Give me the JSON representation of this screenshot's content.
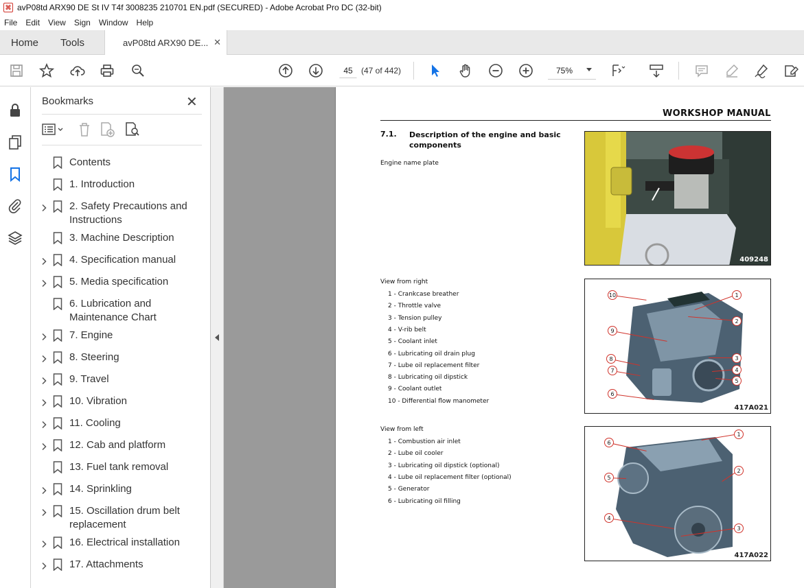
{
  "window": {
    "title": "avP08td ARX90 DE St IV T4f 3008235 210701 EN.pdf (SECURED) - Adobe Acrobat Pro DC (32-bit)"
  },
  "menu": [
    "File",
    "Edit",
    "View",
    "Sign",
    "Window",
    "Help"
  ],
  "tabs": {
    "home": "Home",
    "tools": "Tools",
    "document": "avP08td ARX90 DE..."
  },
  "toolbar": {
    "page_number": "45",
    "page_count": "(47 of 442)",
    "zoom": "75%"
  },
  "bookmarks": {
    "title": "Bookmarks",
    "items": [
      {
        "label": "Contents",
        "expandable": false
      },
      {
        "label": "1. Introduction",
        "expandable": false
      },
      {
        "label": "2. Safety Precautions and Instructions",
        "expandable": true
      },
      {
        "label": "3. Machine Description",
        "expandable": false
      },
      {
        "label": "4. Specification manual",
        "expandable": true
      },
      {
        "label": "5. Media specification",
        "expandable": true
      },
      {
        "label": "6. Lubrication and Maintenance Chart",
        "expandable": false
      },
      {
        "label": "7. Engine",
        "expandable": true
      },
      {
        "label": "8. Steering",
        "expandable": true
      },
      {
        "label": "9. Travel",
        "expandable": true
      },
      {
        "label": "10. Vibration",
        "expandable": true
      },
      {
        "label": "11. Cooling",
        "expandable": true
      },
      {
        "label": "12. Cab and platform",
        "expandable": true
      },
      {
        "label": "13. Fuel tank removal",
        "expandable": false
      },
      {
        "label": "14. Sprinkling",
        "expandable": true
      },
      {
        "label": "15. Oscillation drum belt replacement",
        "expandable": true
      },
      {
        "label": "16. Electrical installation",
        "expandable": true
      },
      {
        "label": "17. Attachments",
        "expandable": true
      }
    ]
  },
  "document": {
    "header": "WORKSHOP MANUAL",
    "section_number": "7.1.",
    "section_title": "Description of the engine and basic components",
    "nameplate_caption": "Engine name plate",
    "photo_code": "409248",
    "view_right": {
      "heading": "View from right",
      "items": [
        "1 - Crankcase breather",
        "2 - Throttle valve",
        "3 - Tension pulley",
        "4 - V-rib belt",
        "5 - Coolant inlet",
        "6 - Lubricating oil drain plug",
        "7 - Lube oil replacement filter",
        "8 - Lubricating oil dipstick",
        "9 - Coolant outlet",
        "10 - Differential flow manometer"
      ],
      "figure_code": "417A021",
      "callouts": [
        "10",
        "1",
        "2",
        "9",
        "3",
        "4",
        "5",
        "8",
        "7",
        "6"
      ]
    },
    "view_left": {
      "heading": "View from left",
      "items": [
        "1 - Combustion air inlet",
        "2 - Lube oil cooler",
        "3 - Lubricating oil dipstick (optional)",
        "4 - Lube oil replacement filter (optional)",
        "5 - Generator",
        "6 - Lubricating oil filling"
      ],
      "figure_code": "417A022",
      "callouts": [
        "6",
        "1",
        "5",
        "2",
        "4",
        "3"
      ]
    }
  },
  "colors": {
    "accent_blue": "#1473e6",
    "callout_red": "#d0332b",
    "page_bg": "#9a9a9a"
  }
}
